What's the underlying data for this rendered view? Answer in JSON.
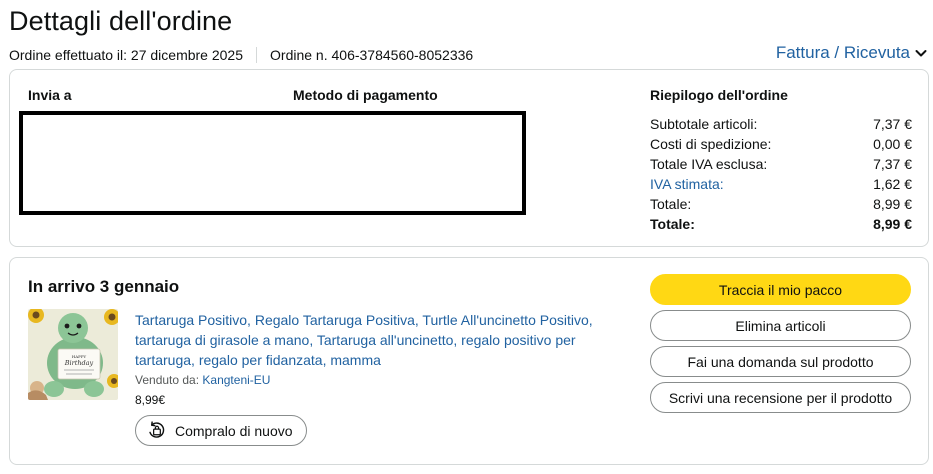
{
  "header": {
    "title": "Dettagli dell'ordine",
    "order_date": "Ordine effettuato il: 27 dicembre 2025",
    "order_number": "Ordine n. 406-3784560-8052336",
    "invoice_link": "Fattura / Ricevuta"
  },
  "details": {
    "ship_to_heading": "Invia a",
    "payment_heading": "Metodo di pagamento"
  },
  "summary": {
    "heading": "Riepilogo dell'ordine",
    "rows": [
      {
        "label": "Subtotale articoli:",
        "value": "7,37 €"
      },
      {
        "label": "Costi di spedizione:",
        "value": "0,00 €"
      },
      {
        "label": "Totale IVA esclusa:",
        "value": "7,37 €"
      },
      {
        "label": "IVA stimata:",
        "value": "1,62 €"
      },
      {
        "label": "Totale:",
        "value": "8,99 €"
      },
      {
        "label": "Totale:",
        "value": "8,99 €"
      }
    ]
  },
  "shipment": {
    "arrival": "In arrivo 3 gennaio",
    "product_title": "Tartaruga Positivo, Regalo Tartaruga Positiva, Turtle All'uncinetto Positivo, tartaruga di girasole a mano, Tartaruga all'uncinetto, regalo positivo per tartaruga, regalo per fidanzata, mamma",
    "sold_by_label": "Venduto da: ",
    "seller_name": "Kangteni-EU",
    "price": "8,99€",
    "buy_again": "Compralo di nuovo"
  },
  "actions": {
    "track": "Traccia il mio pacco",
    "delete": "Elimina articoli",
    "question": "Fai una domanda sul prodotto",
    "review": "Scrivi una recensione per il prodotto"
  },
  "colors": {
    "link": "#2162a1",
    "primary_button": "#ffd814",
    "border": "#d5d9d9"
  },
  "icons": [
    "chevron-down-icon",
    "buy-again-icon"
  ]
}
